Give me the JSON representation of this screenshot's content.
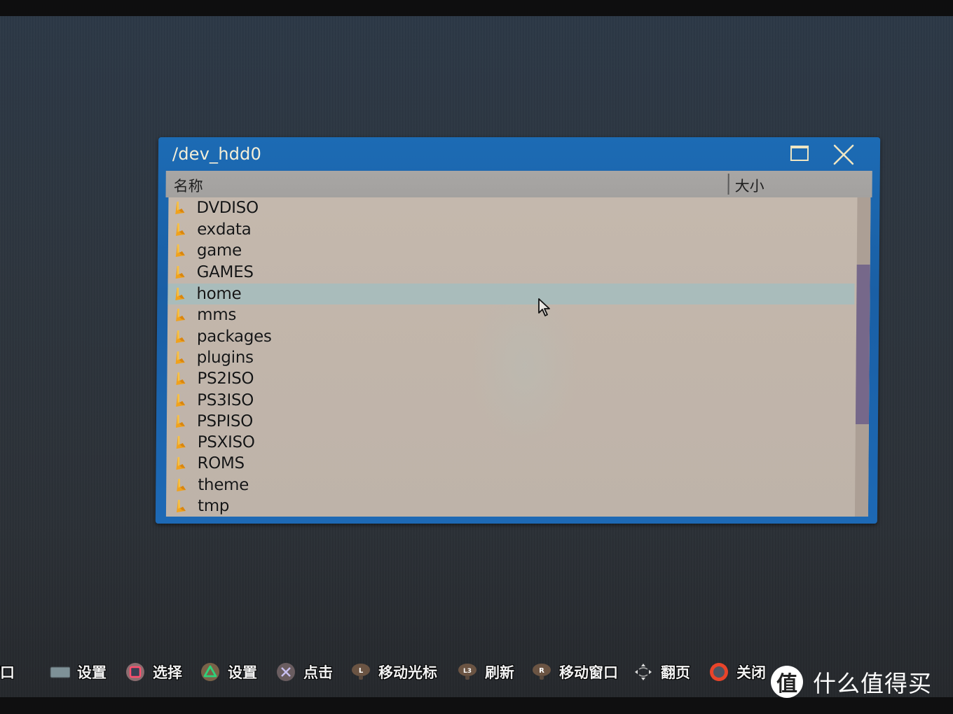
{
  "window": {
    "title": "/dev_hdd0",
    "maximize_icon": "maximize-icon",
    "close_icon": "close-icon",
    "accent_color": "#1c6bb4"
  },
  "list": {
    "columns": {
      "name": "名称",
      "size": "大小"
    },
    "selected_index": 4,
    "items": [
      {
        "name": "DVDISO",
        "icon": "folder-icon",
        "size": ""
      },
      {
        "name": "exdata",
        "icon": "folder-icon",
        "size": ""
      },
      {
        "name": "game",
        "icon": "folder-icon",
        "size": ""
      },
      {
        "name": "GAMES",
        "icon": "folder-icon",
        "size": ""
      },
      {
        "name": "home",
        "icon": "folder-icon",
        "size": ""
      },
      {
        "name": "mms",
        "icon": "folder-icon",
        "size": ""
      },
      {
        "name": "packages",
        "icon": "folder-icon",
        "size": ""
      },
      {
        "name": "plugins",
        "icon": "folder-icon",
        "size": ""
      },
      {
        "name": "PS2ISO",
        "icon": "folder-icon",
        "size": ""
      },
      {
        "name": "PS3ISO",
        "icon": "folder-icon",
        "size": ""
      },
      {
        "name": "PSPISO",
        "icon": "folder-icon",
        "size": ""
      },
      {
        "name": "PSXISO",
        "icon": "folder-icon",
        "size": ""
      },
      {
        "name": "ROMS",
        "icon": "folder-icon",
        "size": ""
      },
      {
        "name": "theme",
        "icon": "folder-icon",
        "size": ""
      },
      {
        "name": "tmp",
        "icon": "folder-icon",
        "size": ""
      }
    ],
    "scroll_position_fraction": 0.21,
    "scroll_visible_fraction": 0.5
  },
  "hints": [
    {
      "icon": "start-button-icon",
      "label": "新窗口"
    },
    {
      "icon": "select-button-icon",
      "label": "设置"
    },
    {
      "icon": "square-button-icon",
      "label": "选择"
    },
    {
      "icon": "triangle-button-icon",
      "label": "设置"
    },
    {
      "icon": "cross-button-icon",
      "label": "点击"
    },
    {
      "icon": "left-stick-icon",
      "label": "移动光标"
    },
    {
      "icon": "l3-button-icon",
      "label": "刷新"
    },
    {
      "icon": "right-stick-icon",
      "label": "移动窗口"
    },
    {
      "icon": "dpad-icon",
      "label": "翻页"
    },
    {
      "icon": "circle-button-icon",
      "label": "关闭"
    }
  ],
  "watermark": {
    "logo_char": "值",
    "text": "什么值得买"
  }
}
